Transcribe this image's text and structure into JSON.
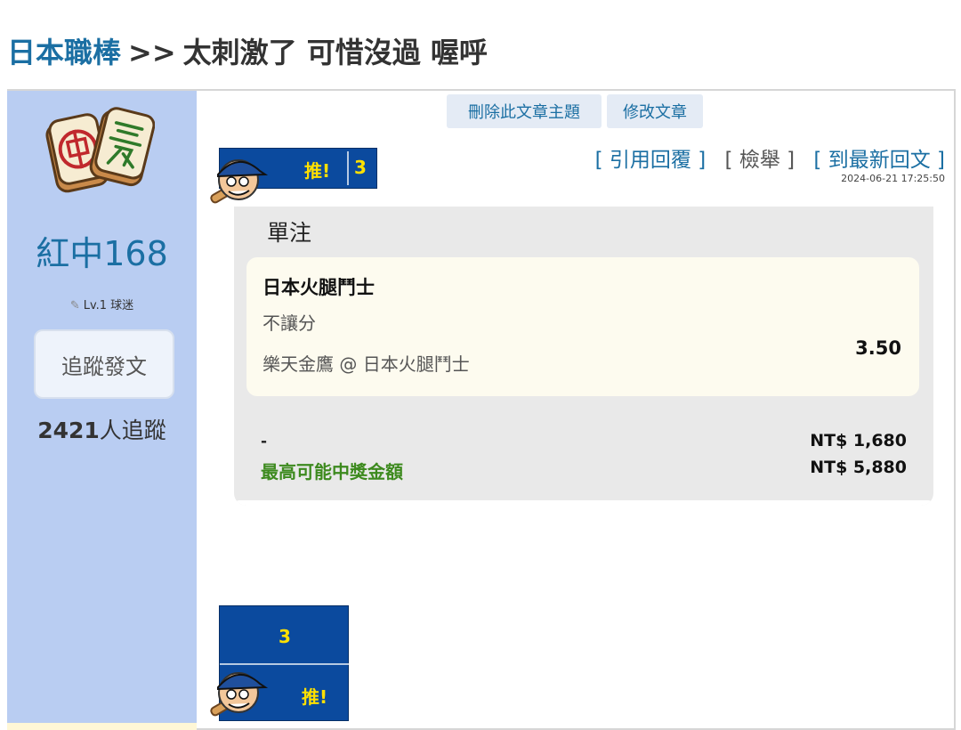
{
  "page": {
    "breadcrumb": "日本職棒",
    "separator": ">>",
    "topic_title": "太刺激了 可惜沒過 喔呼"
  },
  "sidebar": {
    "avatar_icon": "mahjong-tiles-icon",
    "username": "紅中168",
    "level": "Lv.1 球迷",
    "follow_button": "追蹤發文",
    "follower_count": "2421",
    "follower_suffix": "人追蹤"
  },
  "moderation": {
    "delete_topic": "刪除此文章主題",
    "edit_post": "修改文章"
  },
  "push": {
    "label": "推!",
    "count": "3"
  },
  "actions": {
    "quote_reply": "[ 引用回覆 ]",
    "report": "[ 檢舉 ]",
    "latest_reply": "[ 到最新回文 ]",
    "timestamp": "2024-06-21 17:25:50"
  },
  "bet": {
    "type": "單注",
    "team": "日本火腿鬥士",
    "market": "不讓分",
    "match": "樂天金鷹 @ 日本火腿鬥士",
    "odds": "3.50",
    "stake_label": "-",
    "stake_amount": "NT$ 1,680",
    "payout_label": "最高可能中獎金額",
    "payout_amount": "NT$ 5,880"
  },
  "colors": {
    "link_blue": "#1b6fa3",
    "sidebar_bg": "#b9cdf2",
    "badge_blue": "#0b4a9e",
    "badge_yellow": "#ffe000",
    "payout_green": "#3d8a1e"
  }
}
